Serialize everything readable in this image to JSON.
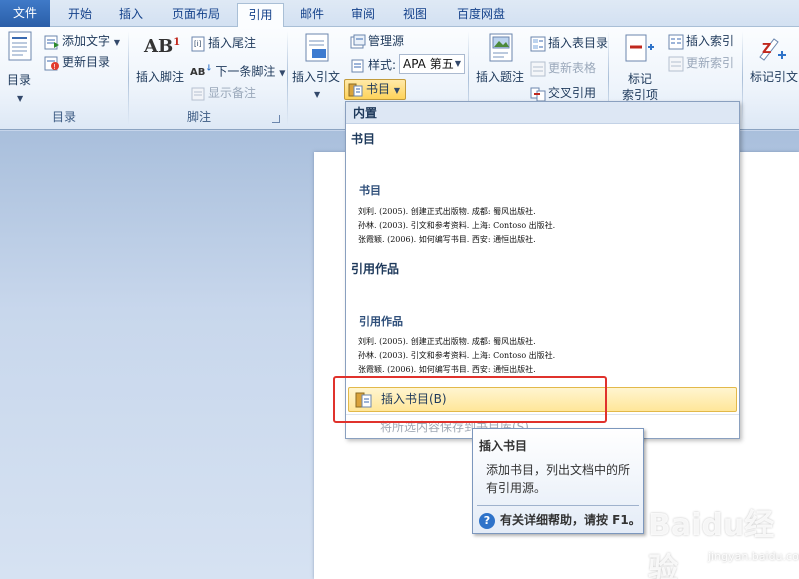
{
  "tabs": [
    {
      "label": "文件",
      "state": "file"
    },
    {
      "label": "开始",
      "state": ""
    },
    {
      "label": "插入",
      "state": ""
    },
    {
      "label": "页面布局",
      "state": ""
    },
    {
      "label": "引用",
      "state": "active"
    },
    {
      "label": "邮件",
      "state": ""
    },
    {
      "label": "审阅",
      "state": ""
    },
    {
      "label": "视图",
      "state": ""
    },
    {
      "label": "百度网盘",
      "state": ""
    }
  ],
  "ribbon": {
    "toc": {
      "button": "目录",
      "add_text": "添加文字",
      "update": "更新目录",
      "group": "目录"
    },
    "footnotes": {
      "insert_footnote": "插入脚注",
      "insert_endnote": "插入尾注",
      "next_footnote": "下一条脚注",
      "show_notes": "显示备注",
      "group": "脚注"
    },
    "citations": {
      "insert_citation": "插入引文",
      "manage_sources": "管理源",
      "style_label": "样式:",
      "style_value": "APA 第五",
      "bibliography": "书目"
    },
    "captions": {
      "insert_caption": "插入题注",
      "insert_table_of_figures": "插入表目录",
      "update_table": "更新表格",
      "cross_reference": "交叉引用"
    },
    "index": {
      "mark_entry_line1": "标记",
      "mark_entry_line2": "索引项",
      "insert_index": "插入索引",
      "update_index": "更新索引"
    },
    "toa": {
      "mark_citation": "标记引文"
    }
  },
  "dropdown": {
    "header": "内置",
    "items": [
      {
        "title": "书目",
        "preview_heading": "书目",
        "lines": [
          "刘利. (2005). 创建正式出版物. 成都: 蜀风出版社.",
          "孙林. (2003). 引文和参考资料. 上海: Contoso 出版社.",
          "张霞颖. (2006). 如何编写书目. 西安: 通恒出版社."
        ]
      },
      {
        "title": "引用作品",
        "preview_heading": "引用作品",
        "lines": [
          "刘利. (2005). 创建正式出版物. 成都: 蜀风出版社.",
          "孙林. (2003). 引文和参考资料. 上海: Contoso 出版社.",
          "张霞颖. (2006). 如何编写书目. 西安: 通恒出版社."
        ]
      }
    ],
    "action": "插入书目(B)",
    "disabled_action": "将所选内容保存到书目库(S)..."
  },
  "tooltip": {
    "title": "插入书目",
    "description": "添加书目，列出文档中的所有引用源。",
    "help": "有关详细帮助，请按 F1。"
  },
  "watermark": {
    "main": "Baidu经验",
    "sub": "jingyan.baidu.com"
  },
  "colors": {
    "file_tab": "#2a5ea8",
    "highlight_box": "#e0322c",
    "hover_item": "#ffe699"
  }
}
